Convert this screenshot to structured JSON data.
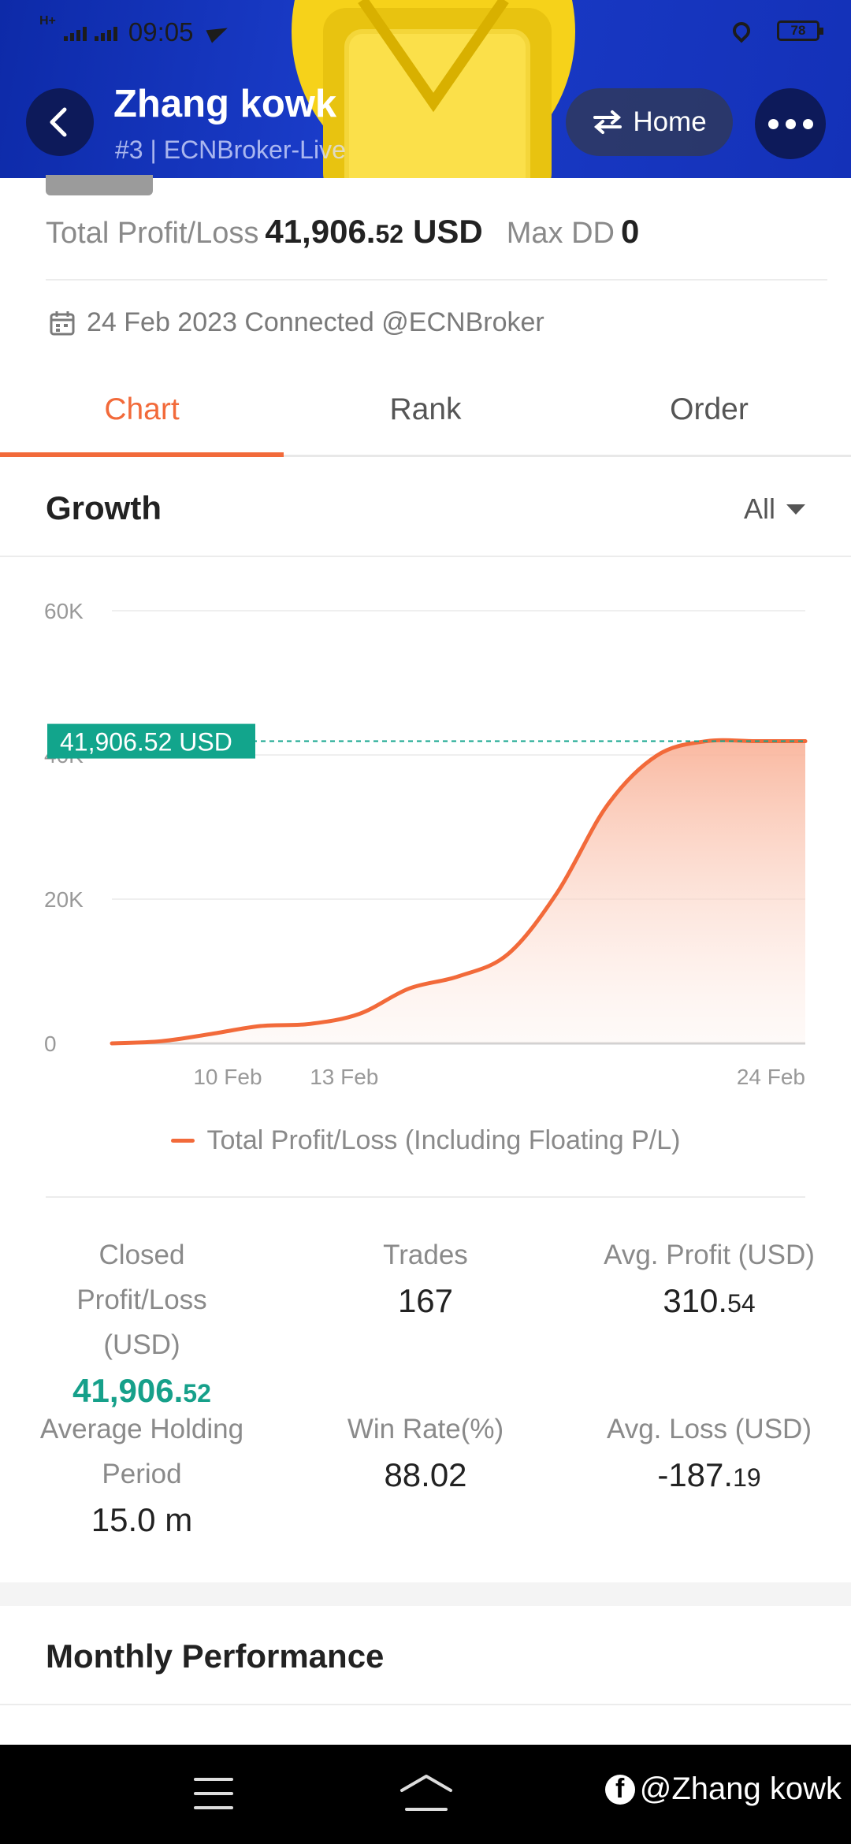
{
  "status_bar": {
    "network": "H+",
    "time": "09:05",
    "battery": "78"
  },
  "header": {
    "title": "Zhang kowk",
    "subtitle": "#3 | ECNBroker-Live",
    "home_label": "Home",
    "back_icon": "chevron-left-icon",
    "more_icon": "more-dots-icon",
    "switch_icon": "swap-arrows-icon"
  },
  "summary": {
    "total_label": "Total Profit/Loss",
    "total_int": "41,906.",
    "total_dec": "52",
    "total_unit": "USD",
    "maxdd_label": "Max DD",
    "maxdd_value": "0"
  },
  "connection": {
    "text": "24 Feb 2023 Connected @ECNBroker",
    "icon": "calendar-icon"
  },
  "tabs": [
    {
      "label": "Chart",
      "active": true
    },
    {
      "label": "Rank",
      "active": false
    },
    {
      "label": "Order",
      "active": false
    }
  ],
  "growth": {
    "title": "Growth",
    "filter": "All"
  },
  "chart_data": {
    "type": "area",
    "y_ticks": [
      "60K",
      "40K",
      "20K",
      "0"
    ],
    "ylim": [
      0,
      60000
    ],
    "x_ticks": [
      "10 Feb",
      "13 Feb",
      "24 Feb"
    ],
    "current_label": "41,906.52 USD",
    "current_value": 41906.52,
    "series": [
      {
        "name": "Total Profit/Loss (Including Floating P/L)",
        "values": [
          0,
          300,
          1300,
          2400,
          2700,
          4100,
          7600,
          9300,
          12400,
          21000,
          33000,
          39900,
          41906.52,
          41906.52,
          41906.52
        ]
      }
    ],
    "legend": "Total Profit/Loss (Including Floating P/L)",
    "colors": {
      "line": "#f26a3a",
      "label_bg": "#12a58c",
      "dash": "#12a58c"
    }
  },
  "stats": {
    "closed_label": "Closed Profit/Loss (USD)",
    "closed_int": "41,906.",
    "closed_dec": "52",
    "trades_label": "Trades",
    "trades_value": "167",
    "avg_profit_label": "Avg. Profit (USD)",
    "avg_profit_int": "310.",
    "avg_profit_dec": "54",
    "holding_label": "Average Holding Period",
    "holding_value": "15.0 m",
    "winrate_label": "Win Rate(%)",
    "winrate_value": "88.02",
    "avg_loss_label": "Avg. Loss (USD)",
    "avg_loss_int": "-187.",
    "avg_loss_dec": "19"
  },
  "monthly": {
    "title": "Monthly Performance"
  },
  "navbar": {
    "watermark": "@Zhang kowk",
    "menu_icon": "menu-icon",
    "home_icon": "home-icon"
  },
  "colors": {
    "accent": "#f26a3a",
    "green": "#16a08a",
    "header_blue": "#1a3cc9"
  }
}
